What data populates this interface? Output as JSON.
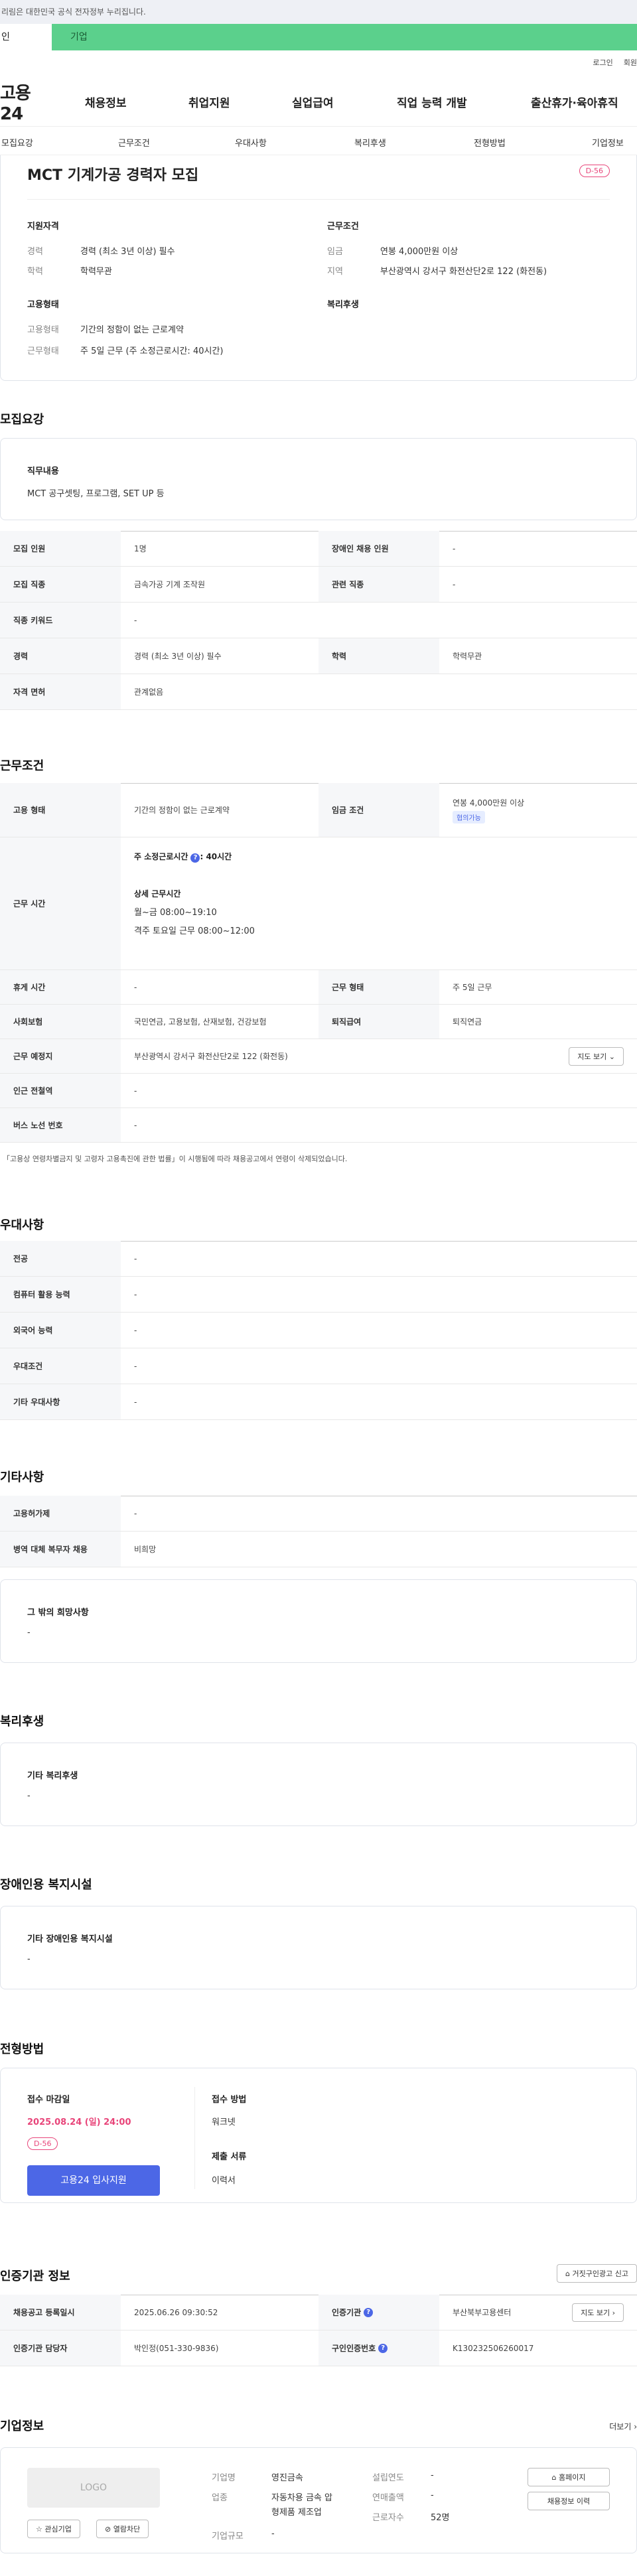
{
  "notice": "리림은 대한민국 공식 전자정부 누리집니다.",
  "user_tabs": [
    "인",
    "기업"
  ],
  "top_links": [
    "로그인",
    "회원"
  ],
  "logo": "고용24",
  "gnb": [
    "채용정보",
    "취업지원",
    "실업급여",
    "직업 능력 개발",
    "출산휴가·육아휴직"
  ],
  "subnav": [
    "모집요강",
    "근무조건",
    "우대사항",
    "복리후생",
    "전형방법",
    "기업정보"
  ],
  "summary": {
    "title": "MCT 기계가공 경력자 모집",
    "dday": "D-56",
    "qual_heading": "지원자격",
    "cond_heading": "근무조건",
    "qual": [
      {
        "label": "경력",
        "value": "경력 (최소 3년 이상) 필수"
      },
      {
        "label": "학력",
        "value": "학력무관"
      }
    ],
    "cond": [
      {
        "label": "임금",
        "value": "연봉 4,000만원 이상"
      },
      {
        "label": "지역",
        "value": "부산광역시 강서구 화전산단2로 122 (화전동)"
      }
    ],
    "emp_heading": "고용형태",
    "welfare_heading": "복리후생",
    "emp": [
      {
        "label": "고용형태",
        "value": "기간의 정함이 없는 근로계약"
      },
      {
        "label": "근무형태",
        "value": "주 5일 근무 (주 소정근로시간: 40시간)"
      }
    ]
  },
  "recruit": {
    "heading": "모집요강",
    "duty_label": "직무내용",
    "duty_value": "MCT 공구셋팅, 프로그램, SET UP 등",
    "rows": [
      [
        "모집 인원",
        "1명",
        "장애인 채용 인원",
        "-"
      ],
      [
        "모집 직종",
        "금속가공 기계 조작원",
        "관련 직종",
        "-"
      ],
      [
        "직종 키워드",
        "-"
      ],
      [
        "경력",
        "경력 (최소 3년 이상) 필수",
        "학력",
        "학력무관"
      ],
      [
        "자격 면허",
        "관계없음"
      ]
    ]
  },
  "work": {
    "heading": "근무조건",
    "emp_type_label": "고용 형태",
    "emp_type": "기간의 정함이 없는 근로계약",
    "wage_label": "임금 조건",
    "wage": "연봉 4,000만원 이상",
    "wage_tag": "협의가능",
    "hours_label": "근무 시간",
    "hours_main": "주 소정근로시간",
    "hours_main_val": ": 40시간",
    "hours_detail_title": "상세 근무시간",
    "hours_detail_1": "월~금 08:00~19:10",
    "hours_detail_2": "격주 토요일 근무 08:00~12:00",
    "rest_label": "휴게 시간",
    "rest": "-",
    "form_label": "근무 형태",
    "form": "주 5일 근무",
    "ins_label": "사회보험",
    "ins": "국민연금, 고용보험, 산재보험, 건강보험",
    "retire_label": "퇴직급여",
    "retire": "퇴직연금",
    "place_label": "근무 예정지",
    "place": "부산광역시 강서구 화전산단2로 122 (화전동)",
    "map_btn": "지도 보기",
    "subway_label": "인근 전철역",
    "subway": "-",
    "bus_label": "버스 노선 번호",
    "bus": "-",
    "note": "「고용상 연령차별금지 및 고령자 고용촉진에 관한 법률」이 시행됨에 따라 채용공고에서 연령이 삭제되었습니다."
  },
  "pref": {
    "heading": "우대사항",
    "rows": [
      [
        "전공",
        "-"
      ],
      [
        "컴퓨터 활용 능력",
        "-"
      ],
      [
        "외국어 능력",
        "-"
      ],
      [
        "우대조건",
        "-"
      ],
      [
        "기타 우대사항",
        "-"
      ]
    ]
  },
  "etc": {
    "heading": "기타사항",
    "rows": [
      [
        "고용허가제",
        "-"
      ],
      [
        "병역 대체 복무자 채용",
        "비희망"
      ]
    ],
    "other_label": "그 밖의 희망사항",
    "other": "-"
  },
  "welfare": {
    "heading": "복리후생",
    "label": "기타 복리후생",
    "value": "-"
  },
  "disabled": {
    "heading": "장애인용 복지시설",
    "label": "기타 장애인용 복지시설",
    "value": "-"
  },
  "apply": {
    "heading": "전형방법",
    "deadline_label": "접수 마감일",
    "deadline": "2025.08.24 (일) 24:00",
    "dday": "D-56",
    "button": "고용24 입사지원",
    "method_label": "접수 방법",
    "method": "워크넷",
    "docs_label": "제출 서류",
    "docs": "이력서"
  },
  "cert": {
    "heading": "인증기관 정보",
    "report_btn": "거짓구인광고 신고",
    "reg_label": "채용공고 등록일시",
    "reg": "2025.06.26 09:30:52",
    "org_label": "인증기관",
    "org": "부산북부고용센터",
    "map_btn": "지도 보기",
    "mgr_label": "인증기관 담당자",
    "mgr": "박인정(051-330-9836)",
    "no_label": "구인인증번호",
    "no": "K130232506260017"
  },
  "company": {
    "heading": "기업정보",
    "more": "더보기",
    "logo": "LOGO",
    "fav_btn": "관심기업",
    "block_btn": "열람차단",
    "name_label": "기업명",
    "name": "영진금속",
    "ind_label": "업종",
    "ind_1": "자동차용 금속 압",
    "ind_2": "형제품 제조업",
    "size_label": "기업규모",
    "size": "-",
    "est_label": "설립연도",
    "est": "-",
    "sales_label": "연매출액",
    "sales": "-",
    "emp_label": "근로자수",
    "emp": "52명",
    "home_btn": "홈페이지",
    "history_btn": "채용정보 이력"
  }
}
